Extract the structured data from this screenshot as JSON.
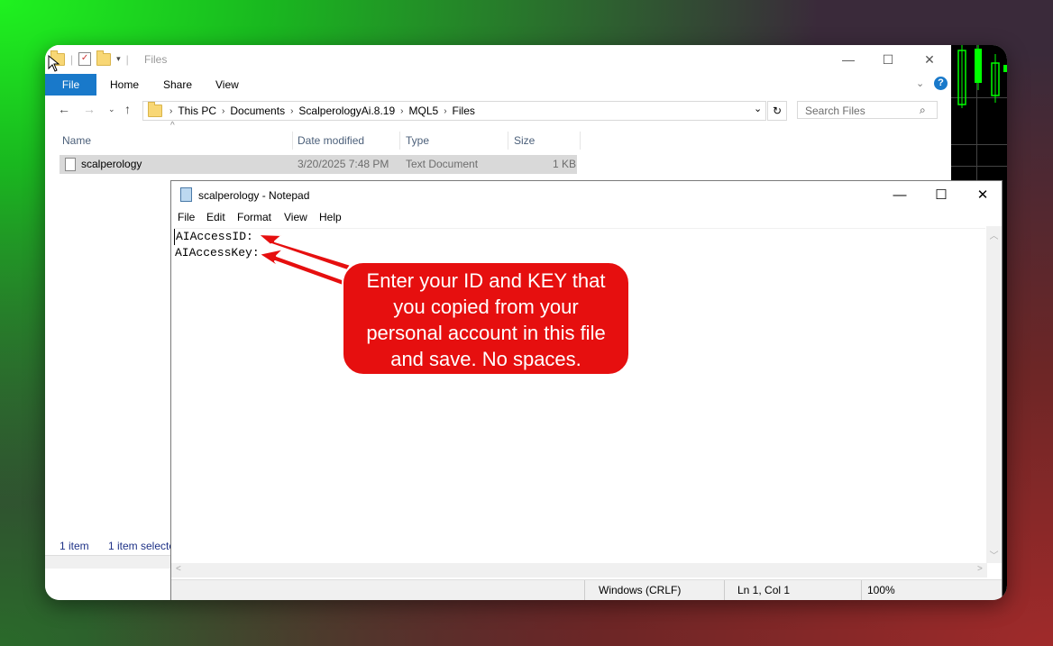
{
  "explorer": {
    "title": "Files",
    "ribbon_tabs": [
      "File",
      "Home",
      "Share",
      "View"
    ],
    "breadcrumbs": [
      "This PC",
      "Documents",
      "ScalperologyAi.8.19",
      "MQL5",
      "Files"
    ],
    "search_placeholder": "Search Files",
    "columns": [
      "Name",
      "Date modified",
      "Type",
      "Size"
    ],
    "file": {
      "name": "scalperology",
      "date": "3/20/2025 7:48 PM",
      "type": "Text Document",
      "size": "1 KB"
    },
    "status": {
      "count": "1 item",
      "selected": "1 item selecte"
    }
  },
  "notepad": {
    "title": "scalperology - Notepad",
    "menu": [
      "File",
      "Edit",
      "Format",
      "View",
      "Help"
    ],
    "lines": [
      "AIAccessID:",
      "AIAccessKey:"
    ],
    "status": {
      "eol": "Windows (CRLF)",
      "position": "Ln 1, Col 1",
      "zoom": "100%"
    }
  },
  "callout": {
    "text_lines": [
      "Enter your ID and KEY that",
      "you copied from your",
      "personal account in this file",
      "and save. No spaces."
    ]
  },
  "colors": {
    "callout": "#e60f0f",
    "file_tab": "#1979ca"
  }
}
